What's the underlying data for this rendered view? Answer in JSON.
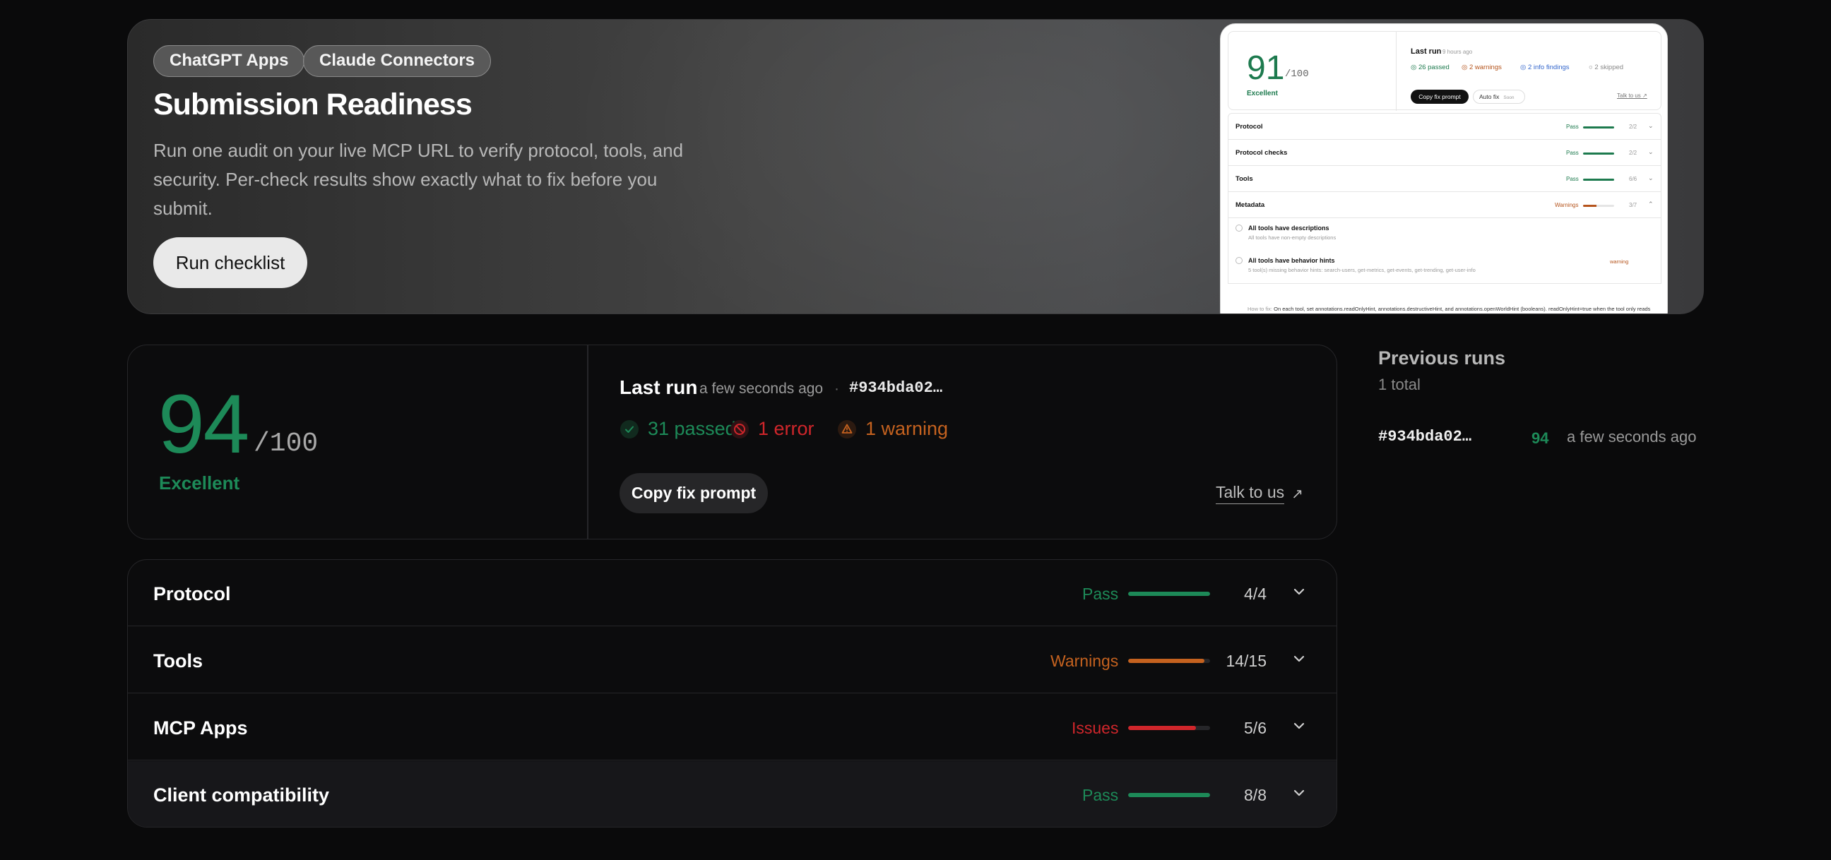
{
  "hero": {
    "chips": [
      "ChatGPT Apps",
      "Claude Connectors"
    ],
    "title": "Submission Readiness",
    "description": "Run one audit on your live MCP URL to verify protocol, tools, and security. Per-check results show exactly what to fix before you submit.",
    "run_button": "Run checklist"
  },
  "preview": {
    "score": "91",
    "score_den": "/100",
    "grade": "Excellent",
    "last_run": "Last run",
    "last_run_time": "9 hours ago",
    "passed": "26 passed",
    "warnings": "2 warnings",
    "info": "2 info findings",
    "skipped": "2 skipped",
    "copy": "Copy fix prompt",
    "autofix": "Auto fix",
    "soon": "Soon",
    "talk": "Talk to us ↗",
    "rows": [
      {
        "label": "Protocol",
        "status": "Pass",
        "count": "2/2",
        "fill": 1.0,
        "color": "#1d7a4e"
      },
      {
        "label": "Protocol checks",
        "status": "Pass",
        "count": "2/2",
        "fill": 1.0,
        "color": "#1d7a4e"
      },
      {
        "label": "Tools",
        "status": "Pass",
        "count": "6/6",
        "fill": 1.0,
        "color": "#1d7a4e"
      },
      {
        "label": "Metadata",
        "status": "Warnings",
        "count": "3/7",
        "fill": 0.43,
        "color": "#b5541c"
      }
    ],
    "item1_title": "All tools have descriptions",
    "item1_sub": "All tools have non-empty descriptions",
    "item2_title": "All tools have behavior hints",
    "item2_sub": "5 tool(s) missing behavior hints: search-users, get-metrics, get-events, get-trending, get-user-info",
    "item2_badge": "warning",
    "fix_label": "How to fix:",
    "fix_text": "On each tool, set annotations.readOnlyHint, annotations.destructiveHint, and annotations.openWorldHint (booleans). readOnlyHint=true when the tool only reads data; destructiveHint=true when it can delete or overwrite user data; openWorldHint=true when it reaches the public internet or untrusted third parties."
  },
  "score_card": {
    "score": "94",
    "score_den": "/100",
    "grade": "Excellent",
    "last_run_label": "Last run",
    "last_run_time": "a few seconds ago",
    "separator": "·",
    "run_hash": "#934bda02…",
    "passed": "31 passed",
    "errors": "1 error",
    "warnings": "1 warning",
    "copy_button": "Copy fix prompt",
    "talk_link": "Talk to us",
    "talk_arrow": "↗"
  },
  "categories": [
    {
      "name": "Protocol",
      "status": "Pass",
      "count": "4/4",
      "fill": 1.0,
      "color": "#1d8a58"
    },
    {
      "name": "Tools",
      "status": "Warnings",
      "count": "14/15",
      "fill": 0.93,
      "color": "#c5621f"
    },
    {
      "name": "MCP Apps",
      "status": "Issues",
      "count": "5/6",
      "fill": 0.83,
      "color": "#d0262b"
    },
    {
      "name": "Client compatibility",
      "status": "Pass",
      "count": "8/8",
      "fill": 1.0,
      "color": "#1d8a58"
    }
  ],
  "previous_runs": {
    "title": "Previous runs",
    "total": "1 total",
    "runs": [
      {
        "hash": "#934bda02…",
        "score": "94",
        "time": "a few seconds ago"
      }
    ]
  },
  "colors": {
    "pass": "#1d8a58",
    "warning": "#c5621f",
    "error": "#d0262b"
  }
}
